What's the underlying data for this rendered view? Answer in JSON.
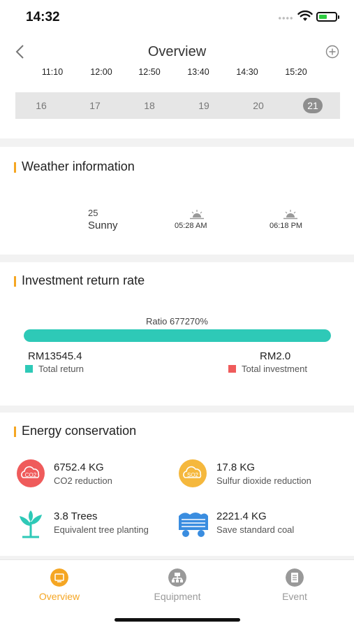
{
  "status": {
    "time": "14:32"
  },
  "header": {
    "title": "Overview",
    "times": [
      "11:10",
      "12:00",
      "12:50",
      "13:40",
      "14:30",
      "15:20"
    ],
    "dates": [
      "16",
      "17",
      "18",
      "19",
      "20",
      "21"
    ],
    "selected_date": "21"
  },
  "weather": {
    "title": "Weather information",
    "temperature": "25",
    "condition": "Sunny",
    "sunrise": "05:28 AM",
    "sunset": "06:18 PM"
  },
  "investment": {
    "title": "Investment return rate",
    "ratio": "Ratio 677270%",
    "bar_fill_fraction": 1.0,
    "total_return_value": "RM13545.4",
    "total_investment_value": "RM2.0",
    "total_return_label": "Total return",
    "total_investment_label": "Total investment",
    "colors": {
      "return": "#2ec9b7",
      "investment": "#ef5b5b"
    }
  },
  "energy": {
    "title": "Energy conservation",
    "items": [
      {
        "icon": "co2-cloud-icon",
        "value": "6752.4 KG",
        "label": "CO2 reduction",
        "badge": "CO2"
      },
      {
        "icon": "so2-cloud-icon",
        "value": "17.8 KG",
        "label": "Sulfur dioxide reduction",
        "badge": "SO2"
      },
      {
        "icon": "tree-icon",
        "value": "3.8 Trees",
        "label": "Equivalent tree planting"
      },
      {
        "icon": "coal-cart-icon",
        "value": "2221.4 KG",
        "label": "Save standard coal"
      }
    ]
  },
  "tabs": [
    {
      "label": "Overview",
      "icon": "overview-icon",
      "active": true
    },
    {
      "label": "Equipment",
      "icon": "equipment-icon",
      "active": false
    },
    {
      "label": "Event",
      "icon": "event-icon",
      "active": false
    }
  ],
  "accent_color": "#f5a623"
}
